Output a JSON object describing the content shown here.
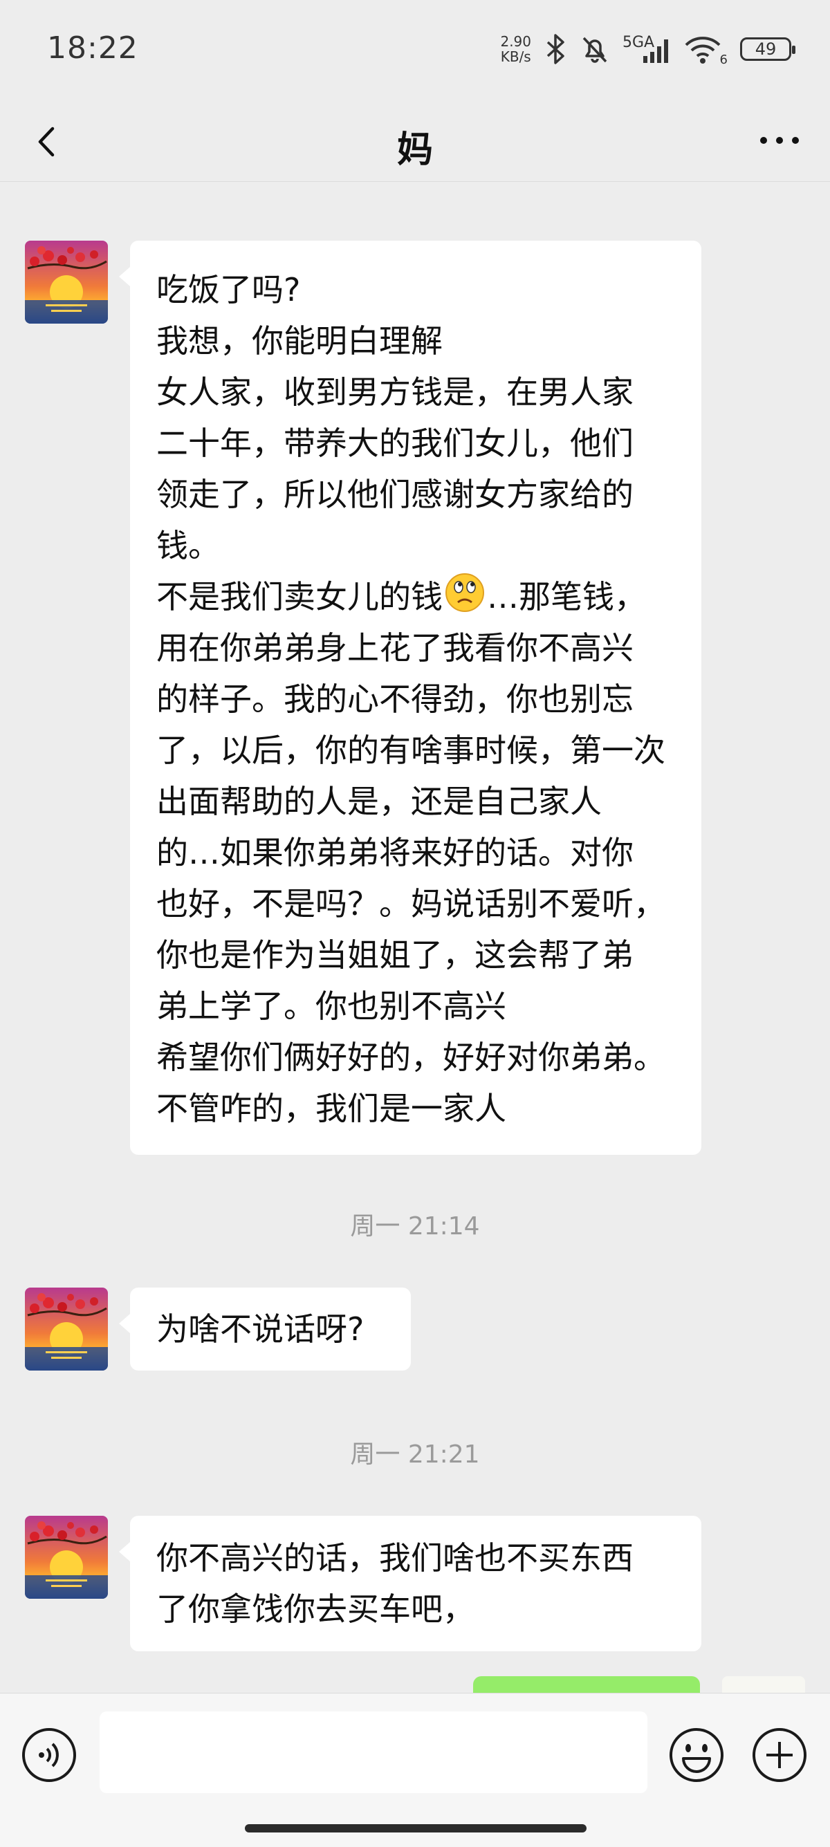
{
  "status_bar": {
    "time": "18:22",
    "net_speed_value": "2.90",
    "net_speed_unit": "KB/s",
    "network": "5GA",
    "wifi_sub": "6",
    "battery": "49"
  },
  "header": {
    "title": "妈"
  },
  "messages": [
    {
      "sender": "妈",
      "lines": [
        "吃饭了吗?",
        "我想，你能明白理解",
        "女人家，收到男方钱是，在男人家",
        "二十年，带养大的我们女儿，他们",
        "领走了，所以他们感谢女方家给的",
        "钱。"
      ],
      "line_with_emoji": {
        "before": "不是我们卖女儿的钱",
        "emoji": "纠结",
        "after": "…那笔钱，"
      },
      "lines_after": [
        "用在你弟弟身上花了我看你不高兴",
        "的样子。我的心不得劲，你也别忘",
        "了，以后，你的有啥事时候，第一次",
        "出面帮助的人是，还是自己家人",
        "的…如果你弟弟将来好的话。对你",
        "也好，不是吗？。妈说话别不爱听，",
        "你也是作为当姐姐了，这会帮了弟",
        "弟上学了。你也别不高兴",
        "希望你们俩好好的，好好对你弟弟。",
        "不管咋的，我们是一家人"
      ]
    },
    {
      "timestamp": "周一 21:14",
      "sender": "妈",
      "lines": [
        "为啥不说话呀?"
      ]
    },
    {
      "timestamp": "周一 21:21",
      "sender": "妈",
      "lines": [
        "你不高兴的话，我们啥也不买东西",
        "了你拿饯你去买车吧，"
      ]
    }
  ],
  "colors": {
    "background": "#ededed",
    "incoming_bubble": "#ffffff",
    "outgoing_bubble": "#95ec69",
    "timestamp_text": "#9a9a9a"
  },
  "icons": [
    "back-arrow-icon",
    "more-icon",
    "voice-icon",
    "emoji-icon",
    "plus-icon",
    "bluetooth-icon",
    "mute-bell-icon",
    "wifi-icon"
  ]
}
